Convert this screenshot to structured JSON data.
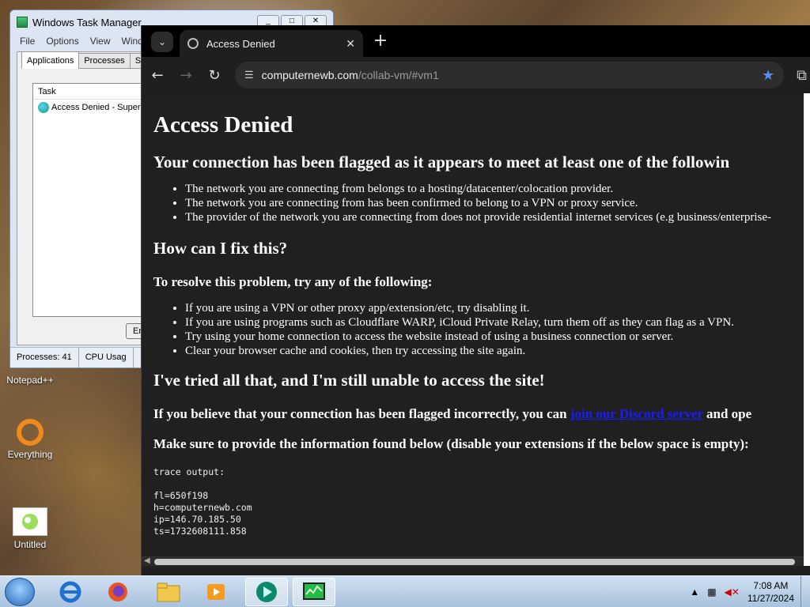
{
  "desktop": {
    "icons": [
      {
        "label": "Notepad++"
      },
      {
        "label": "Everything"
      },
      {
        "label": "Untitled"
      }
    ]
  },
  "task_manager": {
    "title": "Windows Task Manager",
    "menu": [
      "File",
      "Options",
      "View",
      "Windo"
    ],
    "tabs": [
      "Applications",
      "Processes",
      "Serv"
    ],
    "list_header": "Task",
    "tasks": [
      {
        "name": "Access Denied - Superm"
      }
    ],
    "end_button": "End",
    "status": {
      "processes": "Processes: 41",
      "cpu": "CPU Usag"
    }
  },
  "browser": {
    "tab_title": "Access Denied",
    "url_host": "computernewb.com",
    "url_path": "/collab-vm/#vm1",
    "accent": "#5b8def",
    "page": {
      "h1": "Access Denied",
      "flag_heading": "Your connection has been flagged as it appears to meet at least one of the followin",
      "flag_reasons": [
        "The network you are connecting from belongs to a hosting/datacenter/colocation provider.",
        "The network you are connecting from has been confirmed to belong to a VPN or proxy service.",
        "The provider of the network you are connecting from does not provide residential internet services (e.g business/enterprise-"
      ],
      "fix_heading": "How can I fix this?",
      "fix_intro": "To resolve this problem, try any of the following:",
      "fix_steps": [
        "If you are using a VPN or other proxy app/extension/etc, try disabling it.",
        "If you are using programs such as Cloudflare WARP, iCloud Private Relay, turn them off as they can flag as a VPN.",
        "Try using your home connection to access the website instead of using a business connection or server.",
        "Clear your browser cache and cookies, then try accessing the site again."
      ],
      "tried_heading": "I've tried all that, and I'm still unable to access the site!",
      "believe_pre": "If you believe that your connection has been flagged incorrectly, you can ",
      "believe_link": "join our Discord server",
      "believe_post": " and ope",
      "provide_info": "Make sure to provide the information found below (disable your extensions if the below space is empty):",
      "trace": [
        "trace output:",
        "",
        "fl=650f198",
        "h=computernewb.com",
        "ip=146.70.185.50",
        "ts=1732608111.858"
      ]
    }
  },
  "taskbar": {
    "time": "7:08 AM",
    "date": "11/27/2024"
  }
}
